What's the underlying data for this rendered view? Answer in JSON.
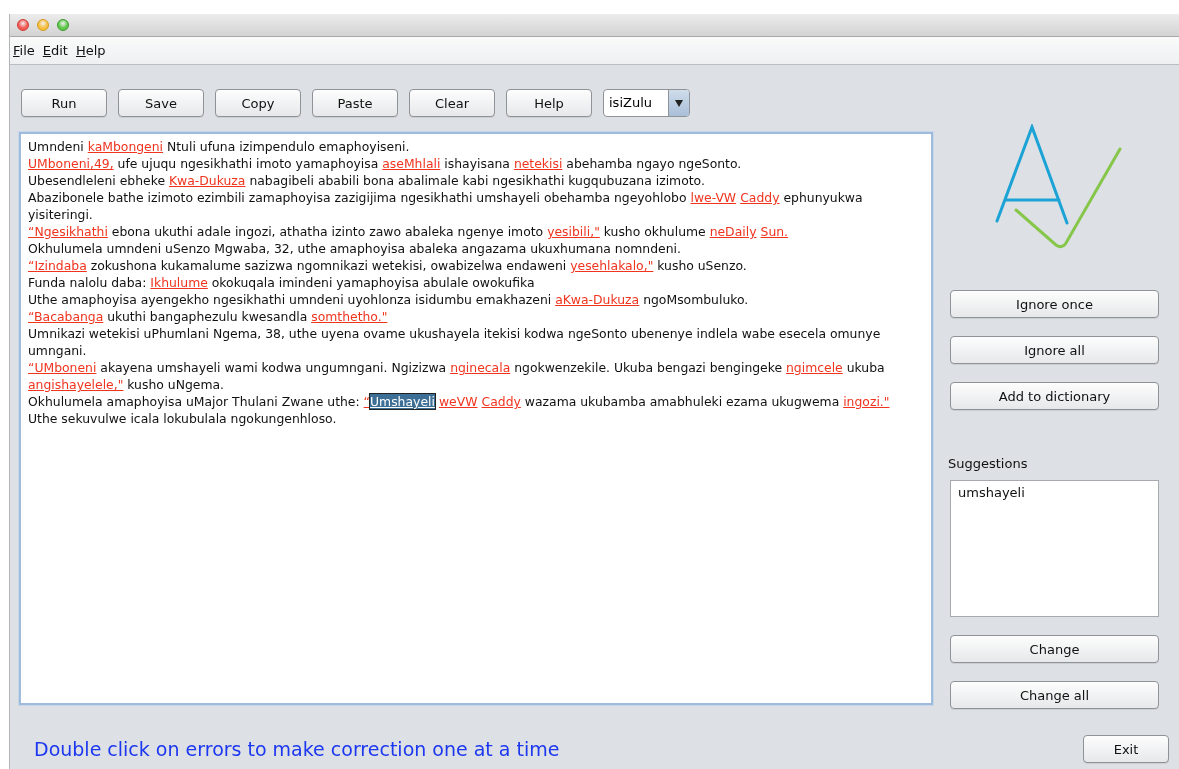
{
  "menu": [
    "File",
    "Edit",
    "Help"
  ],
  "toolbar": {
    "buttons": [
      "Run",
      "Save",
      "Copy",
      "Paste",
      "Clear",
      "Help"
    ],
    "language": {
      "value": "isiZulu"
    }
  },
  "text_area": {
    "lines": [
      {
        "segments": [
          {
            "kind": "plain",
            "text": "Umndeni "
          },
          {
            "kind": "error",
            "text": "kaMbongeni",
            "selected": false
          },
          {
            "kind": "plain",
            "text": " Ntuli ufuna izimpendulo emaphoyiseni."
          }
        ]
      },
      {
        "segments": [
          {
            "kind": "error",
            "text": "UMboneni,49,",
            "selected": false
          },
          {
            "kind": "plain",
            "text": " ufe ujuqu ngesikhathi imoto yamaphoyisa "
          },
          {
            "kind": "error",
            "text": "aseMhlali",
            "selected": false
          },
          {
            "kind": "plain",
            "text": " ishayisana "
          },
          {
            "kind": "error",
            "text": "netekisi",
            "selected": false
          },
          {
            "kind": "plain",
            "text": " abehamba ngayo ngeSonto."
          }
        ]
      },
      {
        "segments": [
          {
            "kind": "plain",
            "text": "Ubesendleleni ebheke "
          },
          {
            "kind": "error",
            "text": "Kwa-Dukuza",
            "selected": false
          },
          {
            "kind": "plain",
            "text": " nabagibeli ababili bona abalimale kabi ngesikhathi kugqubuzana izimoto."
          }
        ]
      },
      {
        "segments": [
          {
            "kind": "plain",
            "text": "Abazibonele bathe izimoto ezimbili zamaphoyisa zazigijima ngesikhathi umshayeli obehamba ngeyohlobo "
          },
          {
            "kind": "error",
            "text": "lwe-VW",
            "selected": false
          },
          {
            "kind": "error",
            "text": "Caddy",
            "selected": false,
            "gap": true
          },
          {
            "kind": "plain",
            "text": " ephunyukwa"
          }
        ]
      },
      {
        "segments": [
          {
            "kind": "plain",
            "text": "yisiteringi."
          }
        ]
      },
      {
        "segments": [
          {
            "kind": "error",
            "text": "“Ngesikhathi",
            "selected": false
          },
          {
            "kind": "plain",
            "text": " ebona ukuthi adale ingozi, athatha izinto zawo abaleka ngenye imoto "
          },
          {
            "kind": "error",
            "text": "yesibili,\"",
            "selected": false
          },
          {
            "kind": "plain",
            "text": " kusho okhulume "
          },
          {
            "kind": "error",
            "text": "neDaily",
            "selected": false
          },
          {
            "kind": "error",
            "text": "Sun.",
            "selected": false,
            "gap": true
          }
        ]
      },
      {
        "segments": [
          {
            "kind": "plain",
            "text": "Okhulumela umndeni uSenzo Mgwaba, 32, uthe amaphoyisa abaleka angazama ukuxhumana nomndeni."
          }
        ]
      },
      {
        "segments": [
          {
            "kind": "error",
            "text": "“Izindaba",
            "selected": false
          },
          {
            "kind": "plain",
            "text": " zokushona kukamalume sazizwa ngomnikazi wetekisi, owabizelwa endaweni "
          },
          {
            "kind": "error",
            "text": "yesehlakalo,\"",
            "selected": false
          },
          {
            "kind": "plain",
            "text": " kusho uSenzo."
          }
        ]
      },
      {
        "segments": [
          {
            "kind": "plain",
            "text": "Funda nalolu daba: "
          },
          {
            "kind": "error",
            "text": "Ikhulume",
            "selected": false
          },
          {
            "kind": "plain",
            "text": " okokuqala imindeni yamaphoyisa abulale owokufika"
          }
        ]
      },
      {
        "segments": [
          {
            "kind": "plain",
            "text": "Uthe amaphoyisa ayengekho ngesikhathi umndeni uyohlonza isidumbu emakhazeni "
          },
          {
            "kind": "error",
            "text": "aKwa-Dukuza",
            "selected": false
          },
          {
            "kind": "plain",
            "text": " ngoMsombuluko."
          }
        ]
      },
      {
        "segments": [
          {
            "kind": "error",
            "text": "“Bacabanga",
            "selected": false
          },
          {
            "kind": "plain",
            "text": " ukuthi bangaphezulu kwesandla "
          },
          {
            "kind": "error",
            "text": "somthetho.\"",
            "selected": false
          }
        ]
      },
      {
        "segments": [
          {
            "kind": "plain",
            "text": "Umnikazi wetekisi uPhumlani Ngema, 38, uthe uyena ovame ukushayela itekisi kodwa ngeSonto ubenenye indlela wabe esecela omunye"
          }
        ]
      },
      {
        "segments": [
          {
            "kind": "plain",
            "text": "umngani."
          }
        ]
      },
      {
        "segments": [
          {
            "kind": "error",
            "text": "“UMboneni",
            "selected": false
          },
          {
            "kind": "plain",
            "text": " akayena umshayeli wami kodwa ungumngani. Ngizizwa "
          },
          {
            "kind": "error",
            "text": "nginecala",
            "selected": false
          },
          {
            "kind": "plain",
            "text": " ngokwenzekile. Ukuba bengazi bengingeke "
          },
          {
            "kind": "error",
            "text": "ngimcele",
            "selected": false
          },
          {
            "kind": "plain",
            "text": " ukuba"
          }
        ]
      },
      {
        "segments": [
          {
            "kind": "error",
            "text": "angishayelele,\"",
            "selected": false
          },
          {
            "kind": "plain",
            "text": " kusho uNgema."
          }
        ]
      },
      {
        "segments": [
          {
            "kind": "plain",
            "text": "Okhulumela amaphoyisa uMajor Thulani Zwane uthe: "
          },
          {
            "kind": "error",
            "text": "“",
            "selected": false
          },
          {
            "kind": "error",
            "text": "Umshayeli",
            "selected": true,
            "gap": false
          },
          {
            "kind": "error",
            "text": "weVW",
            "selected": false,
            "gap": true
          },
          {
            "kind": "error",
            "text": "Caddy",
            "selected": false,
            "gap": true
          },
          {
            "kind": "plain",
            "text": " wazama ukubamba amabhuleki ezama ukugwema "
          },
          {
            "kind": "error",
            "text": "ingozi.\"",
            "selected": false
          }
        ]
      },
      {
        "segments": [
          {
            "kind": "plain",
            "text": "Uthe sekuvulwe icala lokubulala ngokungenhloso."
          }
        ]
      }
    ]
  },
  "side_panel": {
    "actions": [
      "Ignore once",
      "Ignore all",
      "Add to dictionary"
    ],
    "suggestions_label": "Suggestions",
    "suggestions": [
      {
        "text": "umshayeli",
        "selected": false
      }
    ],
    "change_buttons": [
      "Change",
      "Change all"
    ]
  },
  "status": "Double click on errors to make correction one at a time",
  "exit_button": "Exit"
}
